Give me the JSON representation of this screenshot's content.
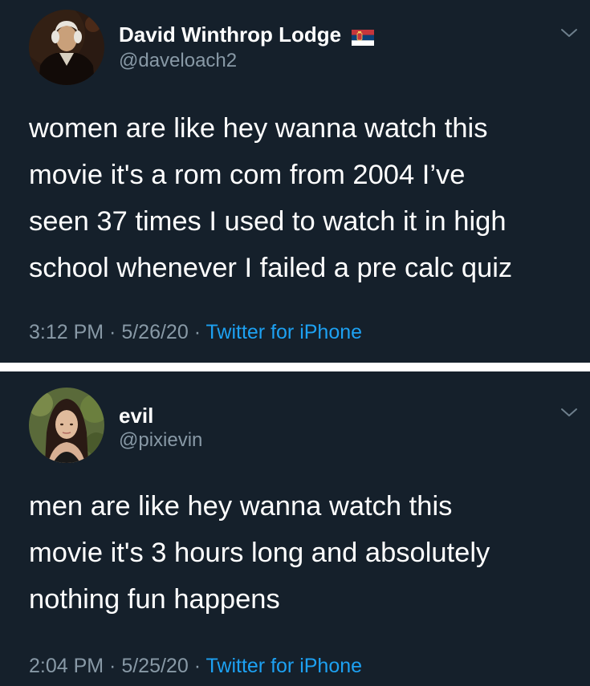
{
  "tweets": [
    {
      "display_name": "David Winthrop Lodge",
      "handle": "@daveloach2",
      "badge_icon": "serbia-flag-icon",
      "body_lines": [
        "women are like hey wanna watch this",
        "movie it's a rom com from 2004 I’ve",
        "seen 37 times I used to watch it in high",
        "school whenever I failed a pre calc quiz"
      ],
      "time": "3:12 PM",
      "date": "5/26/20",
      "source": "Twitter for iPhone"
    },
    {
      "display_name": "evil",
      "handle": "@pixievin",
      "body_lines": [
        "men are like hey wanna watch this",
        "movie it's 3 hours long and absolutely",
        "nothing fun happens"
      ],
      "time": "2:04 PM",
      "date": "5/25/20",
      "source": "Twitter for iPhone"
    }
  ],
  "separator": " · ",
  "colors": {
    "background": "#15202b",
    "text": "#ffffff",
    "secondary_text": "#8899a6",
    "link": "#1da1f2",
    "divider": "#ffffff"
  }
}
